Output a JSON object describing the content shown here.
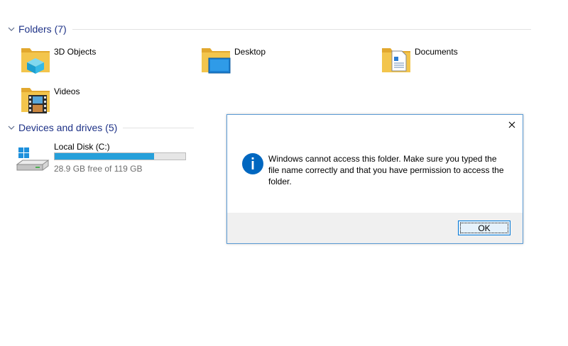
{
  "folders_group": {
    "label": "Folders (7)"
  },
  "folders": [
    {
      "label": "3D Objects",
      "icon": "3d-objects-folder-icon"
    },
    {
      "label": "Desktop",
      "icon": "desktop-folder-icon"
    },
    {
      "label": "Documents",
      "icon": "documents-folder-icon"
    },
    {
      "label": "Videos",
      "icon": "videos-folder-icon"
    }
  ],
  "devices_group": {
    "label": "Devices and drives (5)"
  },
  "drive": {
    "name": "Local Disk (C:)",
    "free_text": "28.9 GB free of 119 GB",
    "used_fraction": 0.76
  },
  "dialog": {
    "message": "Windows cannot access this folder. Make sure you typed the file name correctly and that you have permission to access the folder.",
    "ok_label": "OK"
  },
  "colors": {
    "group_header": "#1e3287",
    "folder": "#f3c54c",
    "drive_bar": "#26a0da",
    "info": "#0067c0"
  }
}
